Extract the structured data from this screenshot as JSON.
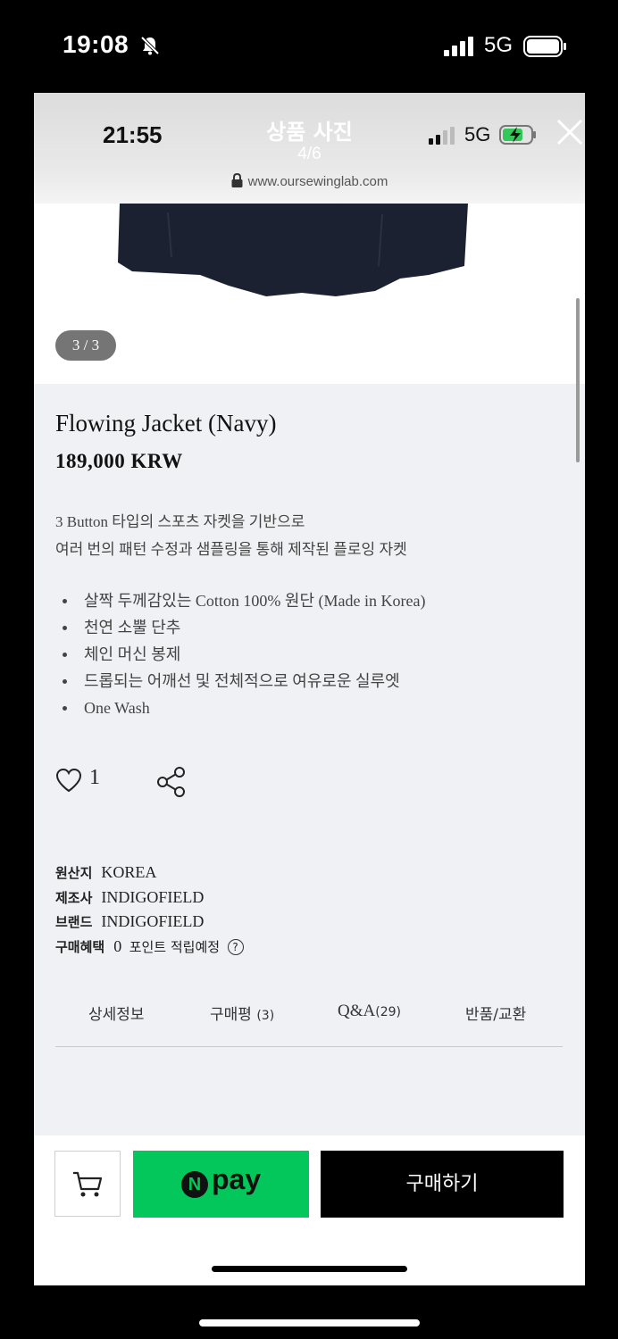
{
  "outer_status": {
    "time": "19:08",
    "network": "5G"
  },
  "inner_status": {
    "time": "21:55",
    "network": "5G"
  },
  "viewer": {
    "title": "상품 사진",
    "counter": "4/6",
    "url": "www.oursewinglab.com"
  },
  "gallery": {
    "pager": "3 / 3"
  },
  "product": {
    "name": "Flowing Jacket (Navy)",
    "price": "189,000 KRW",
    "description": [
      "3 Button 타입의 스포츠 자켓을 기반으로",
      "여러 번의 패턴 수정과 샘플링을 통해 제작된 플로잉 자켓"
    ],
    "features": [
      "살짝 두께감있는 Cotton 100% 원단 (Made in Korea)",
      "천연 소뿔 단추",
      "체인 머신 봉제",
      "드롭되는 어깨선 및 전체적으로 여유로운 실루엣",
      "One Wash"
    ],
    "likes": "1"
  },
  "info": {
    "origin_label": "원산지",
    "origin": "KOREA",
    "maker_label": "제조사",
    "maker": "INDIGOFIELD",
    "brand_label": "브랜드",
    "brand": "INDIGOFIELD",
    "benefit_label": "구매혜택",
    "benefit_points": "0",
    "benefit_text": "포인트 적립예정",
    "help_glyph": "?"
  },
  "tabs": [
    {
      "label": "상세정보",
      "count": ""
    },
    {
      "label": "구매평",
      "count": "(3)"
    },
    {
      "label": "Q&A",
      "count": "(29)"
    },
    {
      "label": "반품/교환",
      "count": ""
    }
  ],
  "bottom": {
    "npay_n": "N",
    "npay_label": "pay",
    "buy_label": "구매하기"
  },
  "icons": [
    "bell-slash-icon",
    "signal-icon",
    "battery-icon",
    "lock-icon",
    "close-icon",
    "heart-icon",
    "share-icon",
    "cart-icon",
    "help-icon"
  ],
  "colors": {
    "npay_green": "#03c75a",
    "buy_black": "#000000",
    "page_bg": "#f0f1f5"
  }
}
